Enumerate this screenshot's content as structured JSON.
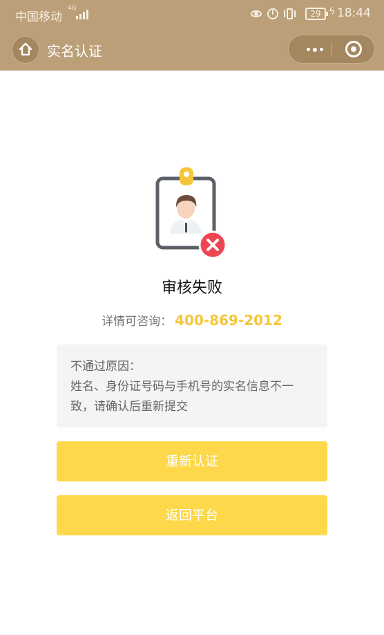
{
  "status_bar": {
    "carrier": "中国移动",
    "network": "4G",
    "battery": "29",
    "time": "18:44"
  },
  "nav": {
    "title": "实名认证",
    "home_icon": "home-icon",
    "more_icon": "more-icon",
    "close_icon": "miniapp-close-icon"
  },
  "result": {
    "title": "审核失败",
    "contact_label": "详情可咨询：",
    "phone": "400-869-2012"
  },
  "reason": {
    "label": "不通过原因：",
    "text": "姓名、身份证号码与手机号的实名信息不一致，请确认后重新提交"
  },
  "buttons": {
    "retry": "重新认证",
    "back": "返回平台"
  },
  "colors": {
    "header": "#bb9f78",
    "accent": "#fcd84a",
    "phone": "#f5c63b",
    "error": "#ef4452"
  }
}
